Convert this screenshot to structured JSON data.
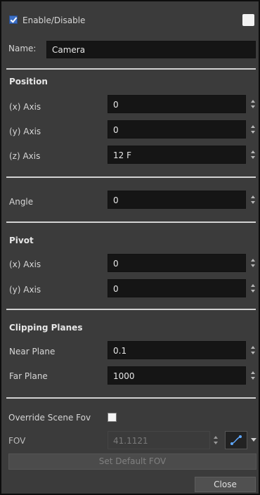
{
  "header": {
    "enable_label": "Enable/Disable"
  },
  "name": {
    "label": "Name:",
    "value": "Camera"
  },
  "position": {
    "title": "Position",
    "x_label": "(x) Axis",
    "x_value": "0",
    "y_label": "(y) Axis",
    "y_value": "0",
    "z_label": "(z) Axis",
    "z_value": "12 F"
  },
  "angle": {
    "label": "Angle",
    "value": "0"
  },
  "pivot": {
    "title": "Pivot",
    "x_label": "(x) Axis",
    "x_value": "0",
    "y_label": "(y) Axis",
    "y_value": "0"
  },
  "clipping": {
    "title": "Clipping Planes",
    "near_label": "Near Plane",
    "near_value": "0.1",
    "far_label": "Far Plane",
    "far_value": "1000"
  },
  "fov": {
    "override_label": "Override Scene Fov",
    "label": "FOV",
    "value": "41.1121",
    "set_default_label": "Set Default FOV"
  },
  "footer": {
    "close_label": "Close"
  }
}
